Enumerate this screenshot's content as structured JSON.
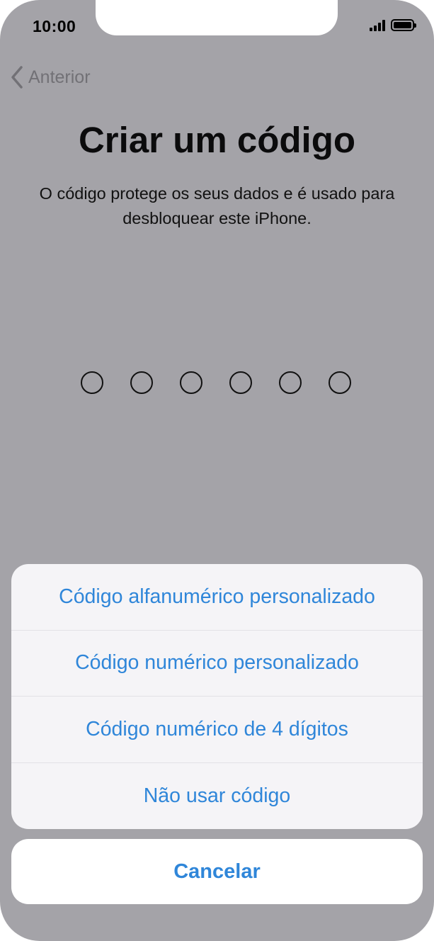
{
  "status_bar": {
    "time": "10:00",
    "signal_icon": "cellular-signal-icon",
    "battery_icon": "battery-icon"
  },
  "nav": {
    "back_label": "Anterior",
    "back_icon": "chevron-left-icon"
  },
  "header": {
    "title": "Criar um código",
    "subtitle": "O código protege os seus dados e é usado para desbloquear este iPhone."
  },
  "passcode": {
    "length": 6,
    "filled": 0
  },
  "action_sheet": {
    "options": [
      {
        "label": "Código alfanumérico personalizado"
      },
      {
        "label": "Código numérico personalizado"
      },
      {
        "label": "Código numérico de 4 dígitos"
      },
      {
        "label": "Não usar código"
      }
    ],
    "cancel_label": "Cancelar"
  },
  "colors": {
    "accent": "#2f86d9",
    "dimmed_background": "#a4a3a8",
    "sheet_background": "#f5f4f7"
  }
}
